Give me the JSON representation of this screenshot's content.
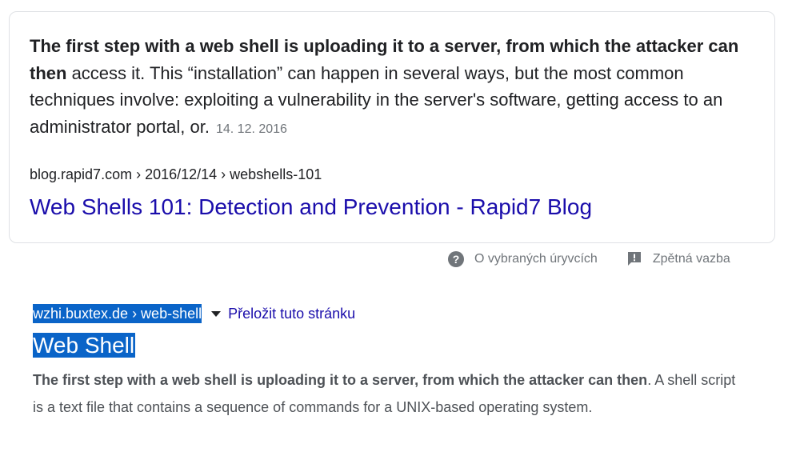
{
  "featured_snippet": {
    "text_bold": "The first step with a web shell is uploading it to a server, from which the attacker can then",
    "text_rest": " access it. This “installation” can happen in several ways, but the most common techniques involve: exploiting a vulnerability in the server's software, getting access to an administrator portal, or.",
    "date": "14. 12. 2016",
    "cite": "blog.rapid7.com › 2016/12/14 › webshells-101",
    "title": "Web Shells 101: Detection and Prevention - Rapid7 Blog"
  },
  "card_footer": {
    "about_label": "O vybraných úryvcích",
    "feedback_label": "Zpětná vazba"
  },
  "result": {
    "cite": "wzhi.buxtex.de › web-shell",
    "translate_label": "Přeložit tuto stránku",
    "title": "Web Shell",
    "desc_bold": "The first step with a web shell is uploading it to a server, from which the attacker can then",
    "desc_rest": ". A shell script is a text file that contains a sequence of commands for a UNIX-based operating system."
  },
  "colors": {
    "link": "#1a0dab",
    "selection": "#0a64c8",
    "muted": "#70757a"
  },
  "icons": {
    "about": "question-circle-icon",
    "feedback": "feedback-flag-icon",
    "dropdown": "triangle-down-icon"
  }
}
